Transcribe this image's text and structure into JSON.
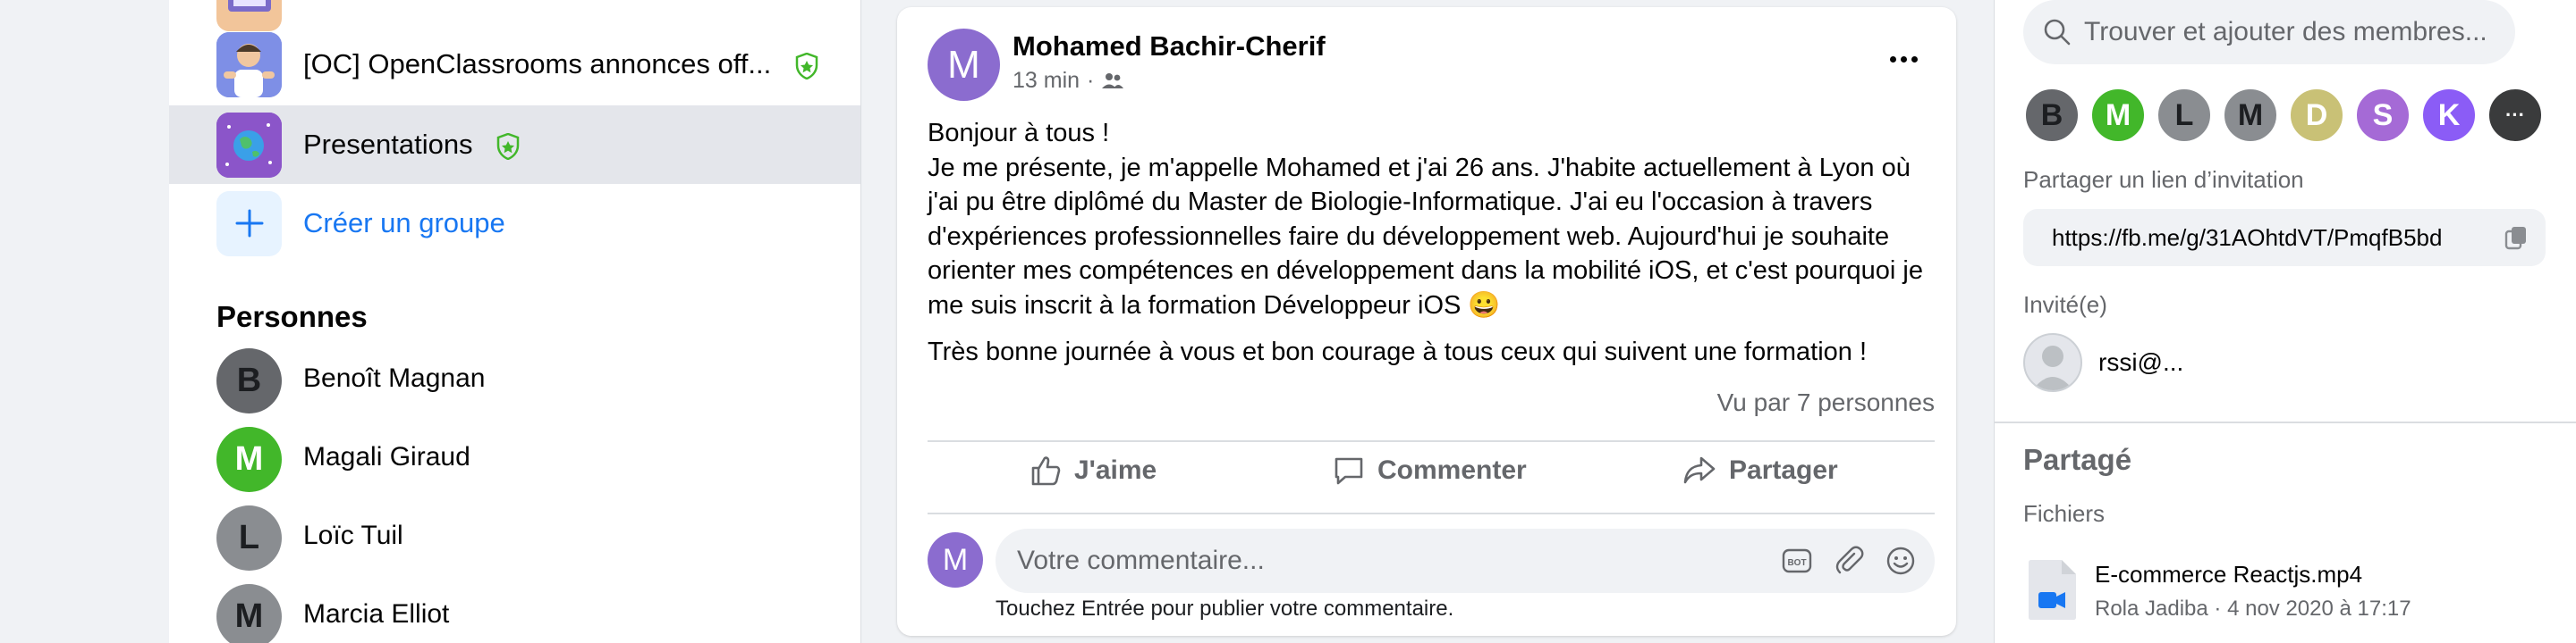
{
  "sidebar": {
    "groups": [
      {
        "label": "[OC] OpenClassrooms annonces off...",
        "badge": "shield-star"
      },
      {
        "label": "Presentations",
        "badge": "shield-star",
        "active": true
      }
    ],
    "create_group_label": "Créer un groupe",
    "people_title": "Personnes",
    "people": [
      {
        "initial": "B",
        "name": "Benoît Magnan",
        "color": "#65676b"
      },
      {
        "initial": "M",
        "name": "Magali Giraud",
        "color": "#42b72a"
      },
      {
        "initial": "L",
        "name": "Loïc Tuil",
        "color": "#8a8d91"
      },
      {
        "initial": "M",
        "name": "Marcia Elliot",
        "color": "#8a8d91"
      }
    ]
  },
  "post": {
    "author_initial": "M",
    "author_name": "Mohamed Bachir-Cherif",
    "time": "13 min",
    "visibility_icon": "group-icon",
    "body_paragraph_1": "Bonjour à tous !\nJe me présente, je m'appelle Mohamed et j'ai 26 ans. J'habite actuellement à Lyon où j'ai pu être diplômé du Master de Biologie-Informatique. J'ai eu l'occasion à travers d'expériences professionnelles faire du développement web. Aujourd'hui je souhaite  orienter mes compétences en développement dans la mobilité iOS, et c'est pourquoi je me suis inscrit à la formation Développeur iOS 😀",
    "body_paragraph_2": "Très bonne journée à vous et bon courage à tous ceux qui suivent une formation !",
    "seen_by": "Vu par 7 personnes",
    "actions": {
      "like": "J'aime",
      "comment": "Commenter",
      "share": "Partager"
    },
    "comment_avatar_initial": "M",
    "comment_placeholder": "Votre commentaire...",
    "comment_hint": "Touchez Entrée pour publier votre commentaire."
  },
  "right_panel": {
    "search_placeholder": "Trouver et ajouter des membres...",
    "members": [
      {
        "initial": "B",
        "color": "#65676b"
      },
      {
        "initial": "M",
        "color": "#42b72a"
      },
      {
        "initial": "L",
        "color": "#8a8d91"
      },
      {
        "initial": "M",
        "color": "#8a8d91"
      },
      {
        "initial": "D",
        "color": "#c9c176"
      },
      {
        "initial": "S",
        "color": "#a56ad6"
      },
      {
        "initial": "K",
        "color": "#8b5cf6"
      },
      {
        "initial": "···",
        "color": "#3a3b3c"
      }
    ],
    "invite_link_label": "Partager un lien d’invitation",
    "invite_link": "https://fb.me/g/31AOhtdVT/PmqfB5bd",
    "invited_label": "Invité(e)",
    "invitee_name": "rssi@...",
    "shared_title": "Partagé",
    "files_label": "Fichiers",
    "file_name": "E-commerce Reactjs.mp4",
    "file_meta": "Rola Jadiba · 4 nov 2020 à 17:17"
  }
}
